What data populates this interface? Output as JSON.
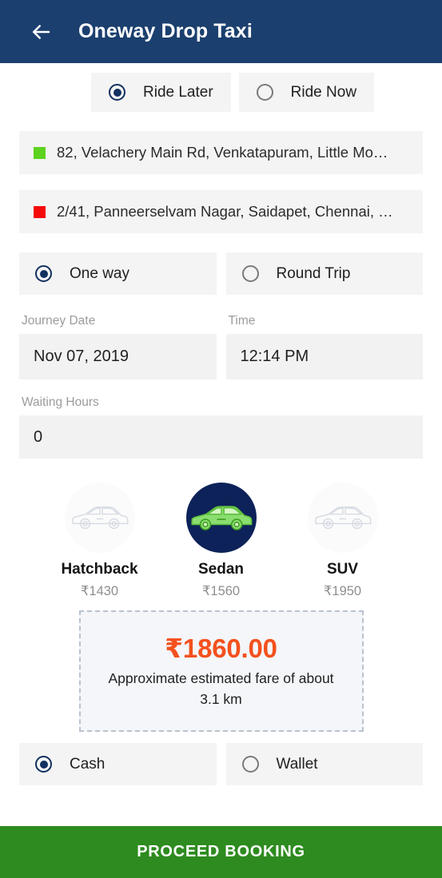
{
  "header": {
    "title": "Oneway Drop Taxi",
    "back_icon": "arrow-left-icon"
  },
  "ride_mode": {
    "options": [
      {
        "label": "Ride Later",
        "selected": true
      },
      {
        "label": "Ride Now",
        "selected": false
      }
    ]
  },
  "locations": {
    "pickup": {
      "text": "82, Velachery Main Rd, Venkatapuram, Little Mo…",
      "marker_color": "#5dd21f"
    },
    "drop": {
      "text": "2/41, Panneerselvam Nagar, Saidapet, Chennai, …",
      "marker_color": "#f50a0a"
    }
  },
  "trip_type": {
    "options": [
      {
        "label": "One way",
        "selected": true
      },
      {
        "label": "Round Trip",
        "selected": false
      }
    ]
  },
  "journey": {
    "date_label": "Journey Date",
    "date_value": "Nov 07, 2019",
    "time_label": "Time",
    "time_value": "12:14 PM"
  },
  "waiting": {
    "label": "Waiting Hours",
    "value": "0"
  },
  "vehicles": [
    {
      "name": "Hatchback",
      "price": "₹1430",
      "selected": false
    },
    {
      "name": "Sedan",
      "price": "₹1560",
      "selected": true
    },
    {
      "name": "SUV",
      "price": "₹1950",
      "selected": false
    }
  ],
  "fare": {
    "amount": "₹1860.00",
    "note_line1": "Approximate estimated fare of about",
    "note_line2": "3.1 km",
    "amount_color": "#f4511e"
  },
  "payment": {
    "options": [
      {
        "label": "Cash",
        "selected": true
      },
      {
        "label": "Wallet",
        "selected": false
      }
    ]
  },
  "proceed": {
    "label": "PROCEED BOOKING",
    "color": "#2e8b1f"
  },
  "theme": {
    "header_navy": "#1b3f6e",
    "selected_vehicle_navy": "#0d2259",
    "car_green": "#8ade6f",
    "field_gray": "#f2f2f2"
  }
}
